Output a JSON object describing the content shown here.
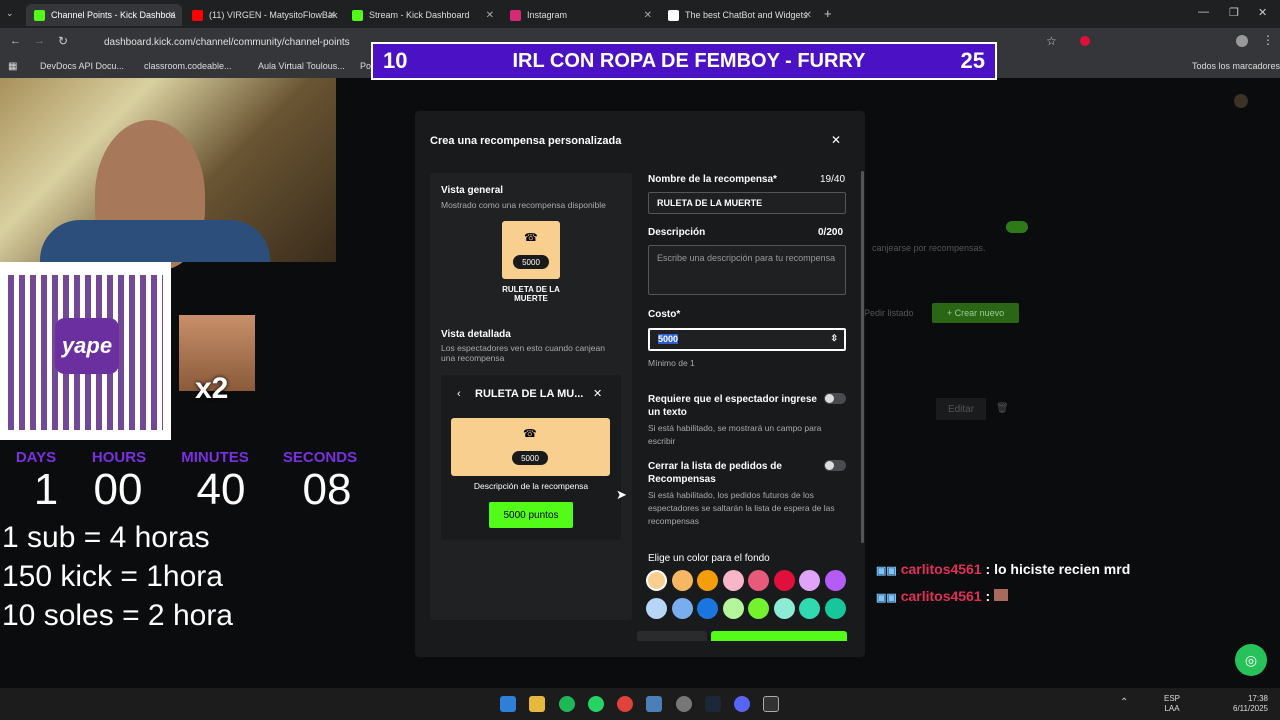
{
  "browser": {
    "tabs": [
      {
        "label": "Channel Points - Kick Dashboa",
        "color": "#53fc18"
      },
      {
        "label": "(11) VIRGEN - MatysitoFlowBak",
        "color": "#ff0000"
      },
      {
        "label": "Stream - Kick Dashboard",
        "color": "#53fc18"
      },
      {
        "label": "Instagram",
        "color": "#d62976"
      },
      {
        "label": "The best ChatBot and Widgets",
        "color": "#ffffff"
      }
    ],
    "new_tab": "+",
    "url": "dashboard.kick.com/channel/community/channel-points",
    "bookmarks": [
      "DevDocs API Docu...",
      "classroom.codeable...",
      "Aula Virtual Toulous...",
      "Po"
    ],
    "all_bookmarks": "Todos los marcadores"
  },
  "overlay": {
    "goal": {
      "left": "10",
      "title": "IRL CON ROPA DE FEMBOY - FURRY",
      "right": "25"
    },
    "qr_brand": "yape",
    "x2": "x2",
    "timer": {
      "labels": [
        "DAYS",
        "HOURS",
        "MINUTES",
        "SECONDS"
      ],
      "values": [
        "1",
        "00",
        "40",
        "08"
      ]
    },
    "rules": [
      "1 sub = 4 horas",
      "150 kick = 1hora",
      "10 soles = 2 hora"
    ]
  },
  "modal": {
    "title": "Crea una recompensa personalizada",
    "close": "✕",
    "overview": {
      "heading": "Vista general",
      "desc": "Mostrado como una recompensa disponible",
      "cost": "5000",
      "name": "RULETA DE LA MUERTE"
    },
    "detail": {
      "heading": "Vista detallada",
      "desc": "Los espectadores ven esto cuando canjean una recompensa",
      "card_title": "RULETA DE LA MU...",
      "cost": "5000",
      "card_desc": "Descripción de la recompensa",
      "button": "5000 puntos"
    },
    "name_label": "Nombre de la recompensa*",
    "name_count": "19/40",
    "name_value": "RULETA DE LA MUERTE",
    "desc_label": "Descripción",
    "desc_count": "0/200",
    "desc_placeholder": "Escribe una descripción para tu recompensa",
    "cost_label": "Costo*",
    "cost_value": "5000",
    "cost_min": "Mínimo de 1",
    "require_text_label": "Requiere que el espectador ingrese un texto",
    "require_text_desc": "Si está habilitado, se mostrará un campo para escribir",
    "close_list_label": "Cerrar la lista de pedidos de Recompensas",
    "close_list_desc": "Si está habilitado, los pedidos futuros de los espectadores se saltarán la lista de espera de las recompensas",
    "color_label": "Elige un color para el fondo",
    "colors": [
      "#f9cf8f",
      "#f7b661",
      "#f59e0b",
      "#f9b6cb",
      "#e85a7c",
      "#e0103c",
      "#dfa4f7",
      "#b45cf5",
      "#b7d6f7",
      "#79aeee",
      "#1a75df",
      "#b4f79b",
      "#74f22e",
      "#8cecd6",
      "#30d9b0",
      "#17c79a"
    ]
  },
  "dashboard_bg": {
    "desc": "canjearse por recompensas.",
    "order_list": "Pedir listado",
    "create": "Crear nuevo",
    "edit": "Editar"
  },
  "chat": [
    {
      "user": "carlitos4561",
      "message": ": lo hiciste recien mrd"
    },
    {
      "user": "carlitos4561",
      "message": ":"
    }
  ],
  "taskbar": {
    "lang": "ESP",
    "lang2": "LAA",
    "time": "17:38",
    "date": "6/11/2025"
  }
}
